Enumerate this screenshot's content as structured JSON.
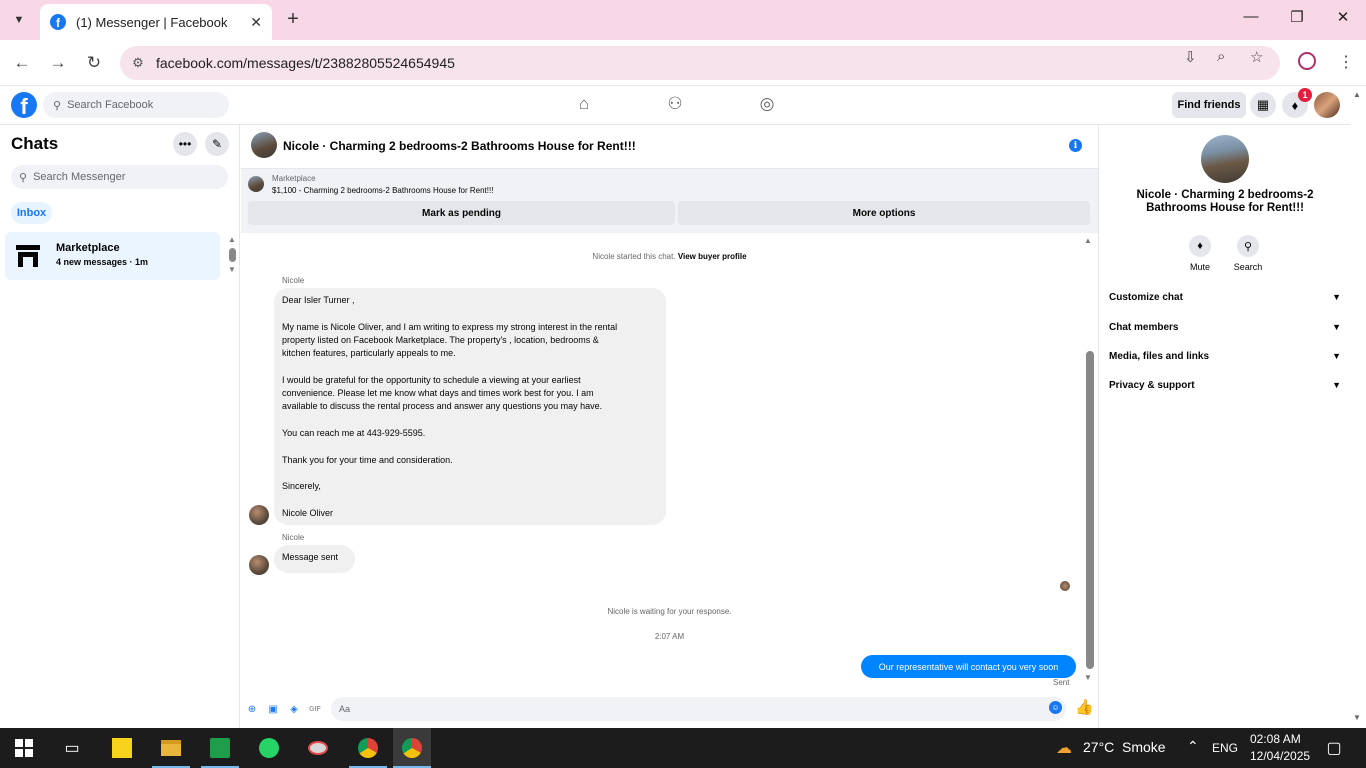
{
  "browser": {
    "tab_title": "(1) Messenger | Facebook",
    "url": "facebook.com/messages/t/23882805524654945",
    "close_tab": "✕",
    "new_tab": "+",
    "minimize": "—",
    "restore": "❐",
    "close_window": "✕"
  },
  "facebook": {
    "search_placeholder": "Search Facebook",
    "find_friends": "Find friends",
    "notification_count": "1"
  },
  "chats": {
    "title": "Chats",
    "search_placeholder": "Search Messenger",
    "inbox_label": "Inbox",
    "items": [
      {
        "name": "Marketplace",
        "sub": "4 new messages · 1m"
      }
    ]
  },
  "conversation": {
    "title": "Nicole · Charming 2 bedrooms-2 Bathrooms House for Rent!!!",
    "marketplace_label": "Marketplace",
    "listing": "$1,100 - Charming 2 bedrooms-2 Bathrooms House for Rent!!!",
    "mark_pending": "Mark as pending",
    "more_options": "More options",
    "started_text": "Nicole started this chat.",
    "view_buyer_profile": "View buyer profile",
    "sender_name": "Nicole",
    "message_lines": [
      "Dear Isler Turner ,",
      "",
      "My name is Nicole Oliver, and I am writing to express my strong interest in the rental",
      "property listed on Facebook Marketplace. The property's , location, bedrooms &",
      "kitchen features, particularly appeals to me.",
      "",
      "I would be grateful for the opportunity to schedule a viewing at your earliest",
      "convenience. Please let me know what days and times work best for you. I am",
      "available to discuss the rental process and answer any questions you may have.",
      "",
      "You can reach me at 443-929-5595.",
      "",
      "Thank you for your time and consideration.",
      "",
      "Sincerely,",
      "",
      "Nicole Oliver"
    ],
    "sender_name_2": "Nicole",
    "message_sent": "Message sent",
    "waiting_text": "Nicole is waiting for your response.",
    "timestamp": "2:07 AM",
    "outgoing": "Our representative will contact you very soon",
    "sent_label": "Sent",
    "composer_placeholder": "Aa"
  },
  "details": {
    "title": "Nicole · Charming 2 bedrooms-2 Bathrooms House for Rent!!!",
    "mute": "Mute",
    "search": "Search",
    "sections": [
      "Customize chat",
      "Chat members",
      "Media, files and links",
      "Privacy & support"
    ]
  },
  "taskbar": {
    "temperature": "27°C",
    "weather": "Smoke",
    "language": "ENG",
    "time": "02:08 AM",
    "date": "12/04/2025"
  },
  "colors": {
    "accent": "#1877f2",
    "outgoing_bubble": "#0084ff",
    "tab_strip": "#f8d7e6"
  }
}
